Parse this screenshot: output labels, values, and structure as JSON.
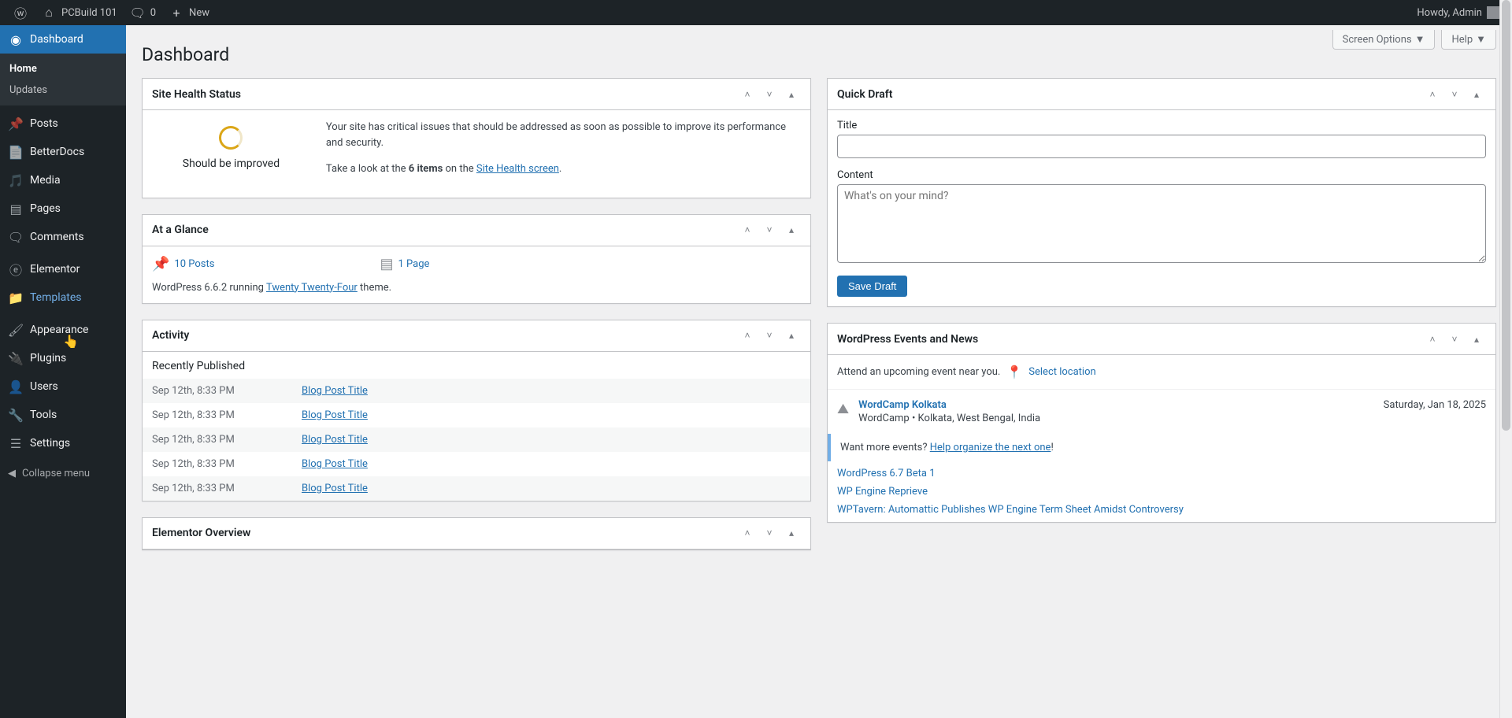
{
  "adminbar": {
    "site_name": "PCBuild 101",
    "comments_count": "0",
    "new_label": "New",
    "howdy": "Howdy, Admin"
  },
  "sidebar": {
    "dashboard": "Dashboard",
    "home": "Home",
    "updates": "Updates",
    "posts": "Posts",
    "betterdocs": "BetterDocs",
    "media": "Media",
    "pages": "Pages",
    "comments": "Comments",
    "elementor": "Elementor",
    "templates": "Templates",
    "appearance": "Appearance",
    "plugins": "Plugins",
    "users": "Users",
    "tools": "Tools",
    "settings": "Settings",
    "collapse": "Collapse menu"
  },
  "top": {
    "screen_options": "Screen Options",
    "help": "Help"
  },
  "page_title": "Dashboard",
  "site_health": {
    "title": "Site Health Status",
    "status_label": "Should be improved",
    "desc": "Your site has critical issues that should be addressed as soon as possible to improve its performance and security.",
    "take_look_prefix": "Take a look at the ",
    "items_bold": "6 items",
    "take_look_mid": " on the ",
    "link": "Site Health screen",
    "period": "."
  },
  "glance": {
    "title": "At a Glance",
    "posts": "10 Posts",
    "pages": "1 Page",
    "wp_prefix": "WordPress 6.6.2 running ",
    "theme": "Twenty Twenty-Four",
    "wp_suffix": " theme."
  },
  "activity": {
    "title": "Activity",
    "section": "Recently Published",
    "rows": [
      {
        "date": "Sep 12th, 8:33 PM",
        "title": "Blog Post Title"
      },
      {
        "date": "Sep 12th, 8:33 PM",
        "title": "Blog Post Title"
      },
      {
        "date": "Sep 12th, 8:33 PM",
        "title": "Blog Post Title"
      },
      {
        "date": "Sep 12th, 8:33 PM",
        "title": "Blog Post Title"
      },
      {
        "date": "Sep 12th, 8:33 PM",
        "title": "Blog Post Title"
      }
    ]
  },
  "elementor_overview": {
    "title": "Elementor Overview"
  },
  "quick_draft": {
    "title": "Quick Draft",
    "title_label": "Title",
    "content_label": "Content",
    "content_placeholder": "What's on your mind?",
    "save": "Save Draft"
  },
  "events": {
    "title": "WordPress Events and News",
    "attend_text": "Attend an upcoming event near you.",
    "select_location": "Select location",
    "event_name": "WordCamp Kolkata",
    "event_loc": "WordCamp • Kolkata, West Bengal, India",
    "event_date": "Saturday, Jan 18, 2025",
    "want_more_prefix": "Want more events? ",
    "help_organize": "Help organize the next one",
    "exclaim": "!",
    "news": [
      "WordPress 6.7 Beta 1",
      "WP Engine Reprieve",
      "WPTavern: Automattic Publishes WP Engine Term Sheet Amidst Controversy"
    ]
  }
}
